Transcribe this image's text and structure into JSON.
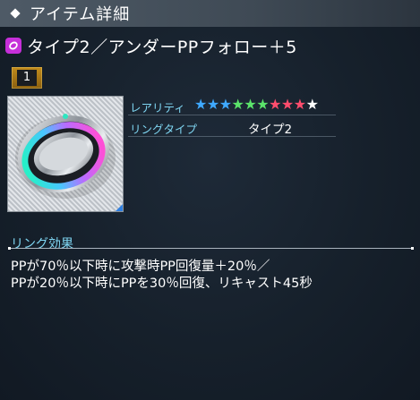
{
  "header": {
    "title": "アイテム詳細"
  },
  "item": {
    "name": "タイプ2／アンダーPPフォロー＋5",
    "quantity": "1",
    "category_icon": "ring-category-icon"
  },
  "info": {
    "rarity_label": "レアリティ",
    "rarity_value": 9,
    "stars": [
      {
        "color": "#3fa9ff"
      },
      {
        "color": "#3fa9ff"
      },
      {
        "color": "#3fa9ff"
      },
      {
        "color": "#5be36a"
      },
      {
        "color": "#5be36a"
      },
      {
        "color": "#5be36a"
      },
      {
        "color": "#ff4d6d"
      },
      {
        "color": "#ff4d6d"
      },
      {
        "color": "#ff4d6d"
      },
      {
        "color": "#ffffff"
      }
    ],
    "ring_type_label": "リングタイプ",
    "ring_type_value": "タイプ2"
  },
  "effect": {
    "title": "リング効果",
    "line1": "PPが70％以下時に攻撃時PP回復量＋20％／",
    "line2": "PPが20％以下時にPPを30％回復、リキャスト45秒"
  },
  "colors": {
    "accent_label": "#7fd6f2",
    "badge_gold": "#c28c1c",
    "ring_category": "#c62fd9"
  }
}
